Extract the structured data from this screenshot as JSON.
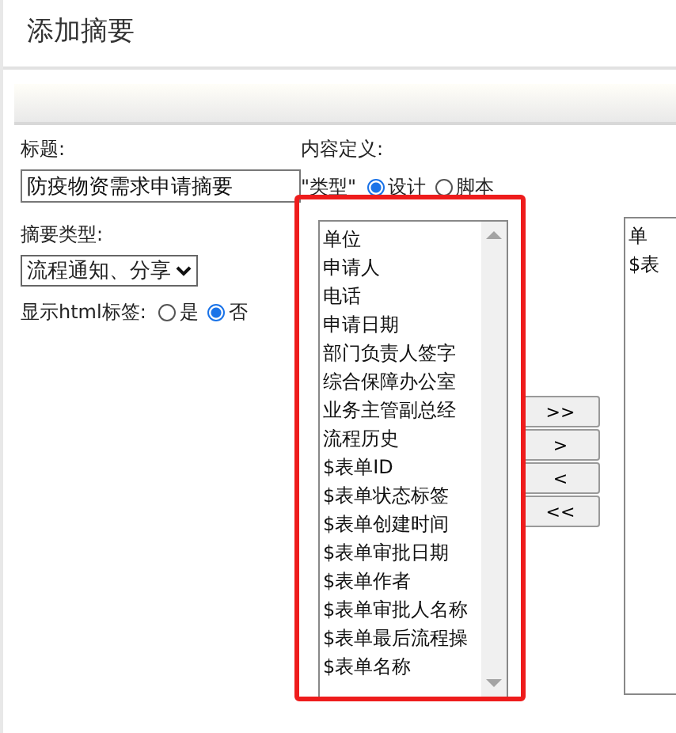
{
  "dialog": {
    "title": "添加摘要"
  },
  "form": {
    "title_label": "标题:",
    "title_value": "防疫物资需求申请摘要",
    "type_label": "摘要类型:",
    "type_value": "流程通知、分享",
    "html_label": "显示html标签:",
    "html_options": [
      {
        "label": "是",
        "selected": false
      },
      {
        "label": "否",
        "selected": true
      }
    ]
  },
  "content": {
    "label": "内容定义:",
    "type_label": "\"类型\"",
    "type_options": [
      {
        "label": "设计",
        "selected": true
      },
      {
        "label": "脚本",
        "selected": false
      }
    ],
    "available_fields": {
      "highlighted": true,
      "items": [
        "单位",
        "申请人",
        "电话",
        "申请日期",
        "部门负责人签字",
        "综合保障办公室",
        "业务主管副总经",
        "流程历史",
        "$表单ID",
        "$表单状态标签",
        "$表单创建时间",
        "$表单审批日期",
        "$表单作者",
        "$表单审批人名称",
        "$表单最后流程操",
        "$表单名称"
      ]
    },
    "move_buttons": [
      ">>",
      ">",
      "<",
      "<<"
    ],
    "selected_fields": {
      "items": [
        "单",
        "$表"
      ]
    }
  }
}
